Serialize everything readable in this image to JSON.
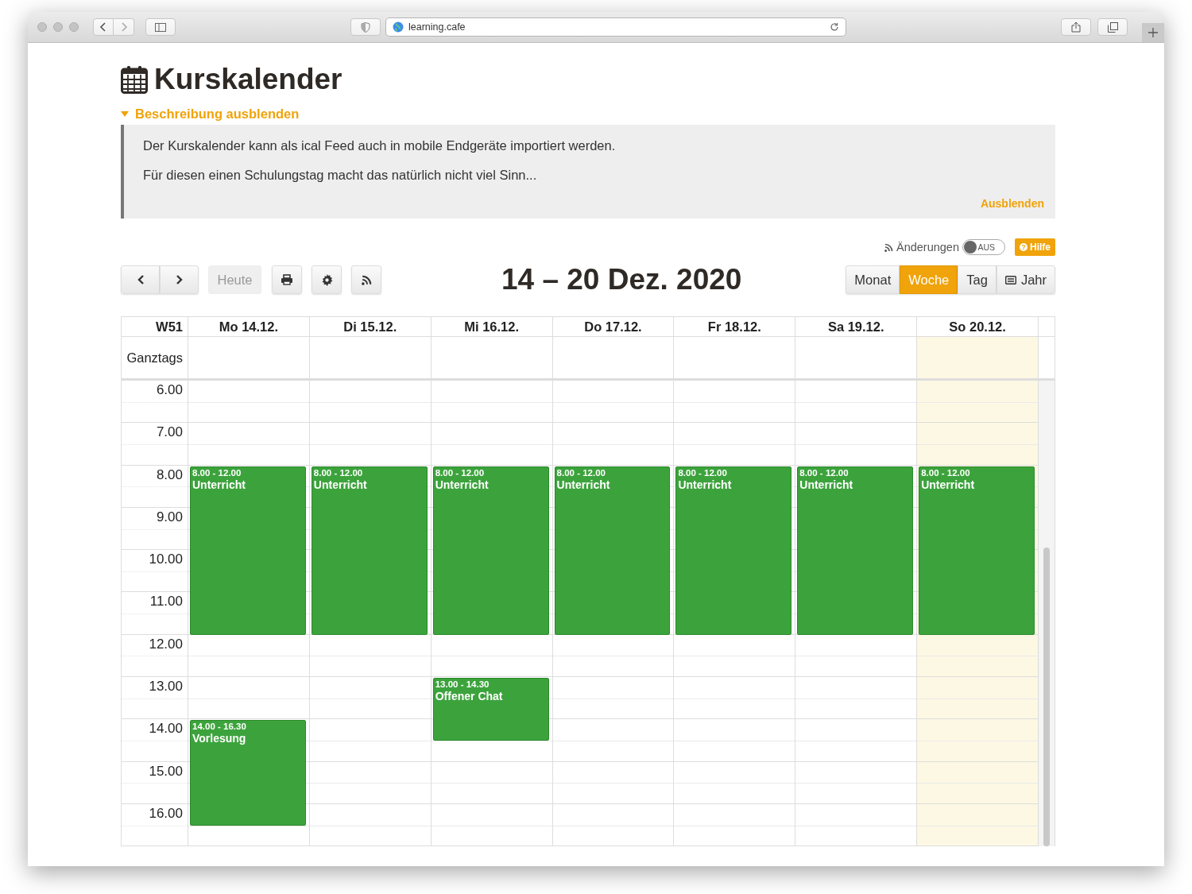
{
  "browser": {
    "url": "learning.cafe"
  },
  "page": {
    "title": "Kurskalender",
    "description_toggle": {
      "label": "Beschreibung ausblenden",
      "expanded": true
    },
    "description": [
      "Der Kurskalender kann als ical Feed auch in mobile Endgeräte importiert werden.",
      "Für diesen einen Schulungstag macht das natürlich nicht viel Sinn..."
    ],
    "hide_link": "Ausblenden"
  },
  "changes": {
    "label": "Änderungen",
    "on": false,
    "state_label": "AUS"
  },
  "help": {
    "glyph": "?",
    "label": "Hilfe"
  },
  "toolbar": {
    "today": "Heute",
    "range": "14 – 20 Dez. 2020"
  },
  "views": [
    {
      "label": "Monat",
      "selected": false
    },
    {
      "label": "Woche",
      "selected": true
    },
    {
      "label": "Tag",
      "selected": false
    },
    {
      "label": "Jahr",
      "selected": false,
      "kind": "icon"
    }
  ],
  "calendar": {
    "week": "W51",
    "allday_label": "Ganztags",
    "hours": [
      "6.00",
      "7.00",
      "8.00",
      "9.00",
      "10.00",
      "11.00",
      "12.00",
      "13.00",
      "14.00",
      "15.00",
      "16.00"
    ],
    "days": [
      {
        "label": "Mo 14.12.",
        "today": false,
        "events": [
          {
            "time": "8.00 - 12.00",
            "title": "Unterricht"
          },
          {
            "time": "14.00 - 16.30",
            "title": "Vorlesung"
          }
        ]
      },
      {
        "label": "Di 15.12.",
        "today": false,
        "events": [
          {
            "time": "8.00 - 12.00",
            "title": "Unterricht"
          }
        ]
      },
      {
        "label": "Mi 16.12.",
        "today": false,
        "events": [
          {
            "time": "8.00 - 12.00",
            "title": "Unterricht"
          },
          {
            "time": "13.00 - 14.30",
            "title": "Offener Chat"
          }
        ]
      },
      {
        "label": "Do 17.12.",
        "today": false,
        "events": [
          {
            "time": "8.00 - 12.00",
            "title": "Unterricht"
          }
        ]
      },
      {
        "label": "Fr 18.12.",
        "today": false,
        "events": [
          {
            "time": "8.00 - 12.00",
            "title": "Unterricht"
          }
        ]
      },
      {
        "label": "Sa 19.12.",
        "today": false,
        "events": [
          {
            "time": "8.00 - 12.00",
            "title": "Unterricht"
          }
        ]
      },
      {
        "label": "So 20.12.",
        "today": true,
        "events": [
          {
            "time": "8.00 - 12.00",
            "title": "Unterricht"
          }
        ]
      }
    ]
  }
}
